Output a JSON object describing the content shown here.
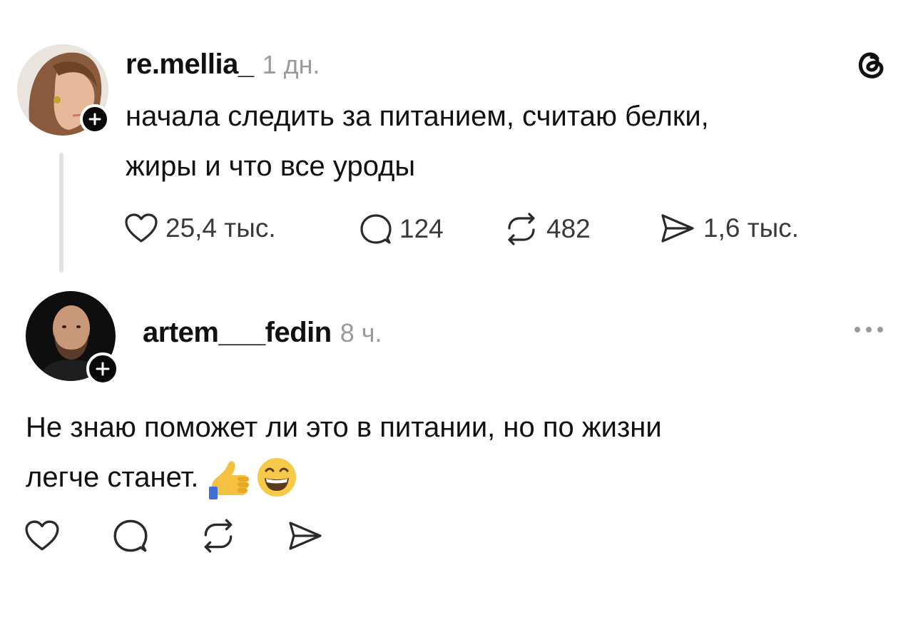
{
  "post": {
    "username": "re.mellia_",
    "time": "1 дн.",
    "text_line1": "начала следить за питанием, считаю белки,",
    "text_line2": "жиры и что все уроды",
    "likes": "25,4 тыс.",
    "comments": "124",
    "reposts": "482",
    "shares": "1,6 тыс.",
    "app_icon": "threads-logo-icon"
  },
  "reply": {
    "username": "artem___fedin",
    "time": "8 ч.",
    "text_line1": "Не знаю поможет ли это в питании, но по жизни",
    "text_line2": "легче станет.",
    "emojis": [
      "thumbs-up",
      "grinning-face"
    ],
    "more_icon": "more-dots-icon"
  },
  "colors": {
    "text": "#0a0a0a",
    "muted": "#9a9a9a",
    "thread_line": "#e2e2e2",
    "icon": "#2a2a2a"
  }
}
